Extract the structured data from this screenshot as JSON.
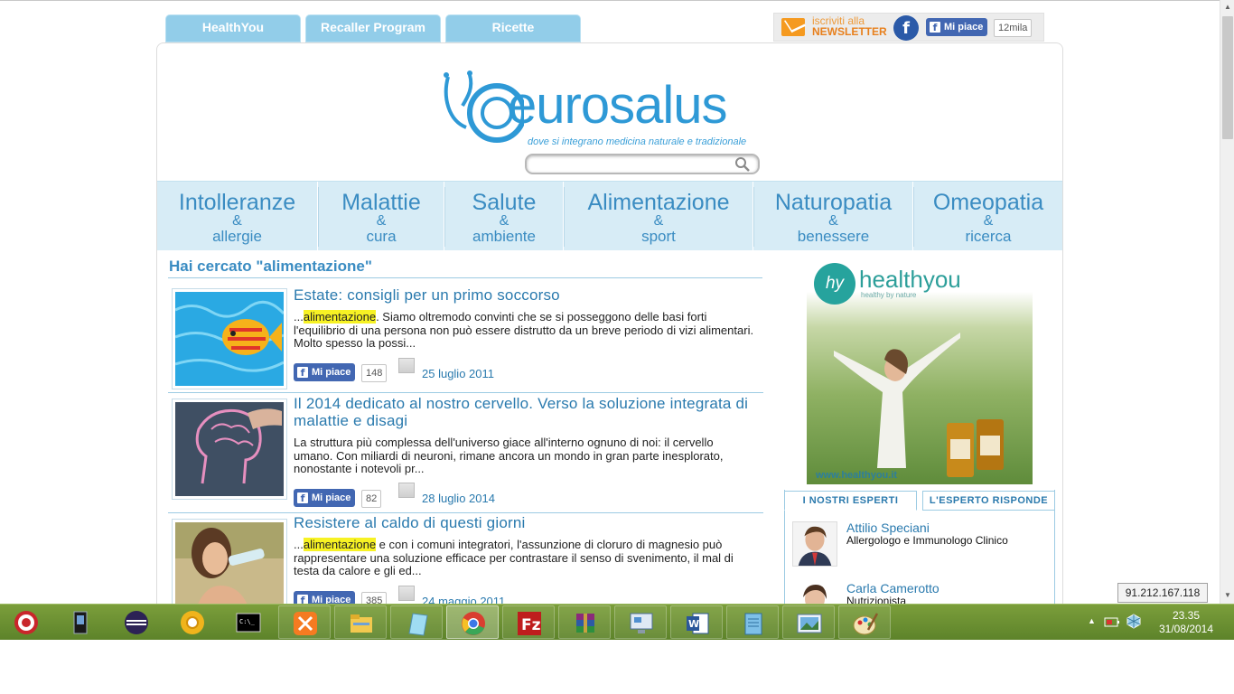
{
  "top_tabs": [
    "HealthYou",
    "Recaller Program",
    "Ricette"
  ],
  "social": {
    "newsletter_top": "iscriviti alla",
    "newsletter_bottom": "NEWSLETTER",
    "fb_letter": "f",
    "like_label": "Mi piace",
    "like_count": "12mila"
  },
  "logo": {
    "brand": "eurosalus",
    "tagline": "dove si integrano medicina naturale e tradizionale"
  },
  "search": {
    "value": ""
  },
  "nav": [
    {
      "main": "Intolleranze",
      "amp": "&",
      "sub": "allergie"
    },
    {
      "main": "Malattie",
      "amp": "&",
      "sub": "cura"
    },
    {
      "main": "Salute",
      "amp": "&",
      "sub": "ambiente"
    },
    {
      "main": "Alimentazione",
      "amp": "&",
      "sub": "sport"
    },
    {
      "main": "Naturopatia",
      "amp": "&",
      "sub": "benessere"
    },
    {
      "main": "Omeopatia",
      "amp": "&",
      "sub": "ricerca"
    }
  ],
  "results_title": "Hai cercato \"alimentazione\"",
  "results": [
    {
      "title": "Estate: consigli per un primo soccorso",
      "text_pre": "...",
      "highlight": "alimentazione",
      "text_post": ". Siamo oltremodo convinti che se si posseggono delle basi forti l'equilibrio di una persona non può essere distrutto da un breve periodo di vizi alimentari. Molto spesso la possi...",
      "like_label": "Mi piace",
      "like_count": "148",
      "date": "25 luglio 2011"
    },
    {
      "title": "Il 2014 dedicato al nostro cervello. Verso la soluzione integrata di malattie e disagi",
      "text_pre": "La struttura più complessa dell'universo giace all'interno ognuno di noi: il cervello umano. Con miliardi di neuroni, rimane ancora un mondo in gran parte inesplorato, nonostante i notevoli pr...",
      "highlight": "",
      "text_post": "",
      "like_label": "Mi piace",
      "like_count": "82",
      "date": "28 luglio 2014"
    },
    {
      "title": "Resistere al caldo di questi giorni",
      "text_pre": "...",
      "highlight": "alimentazione",
      "text_post": " e con i comuni integratori, l'assunzione di cloruro di magnesio può rappresentare una soluzione efficace per contrastare il senso di svenimento, il mal di testa da calore e gli ed...",
      "like_label": "Mi piace",
      "like_count": "385",
      "date": "24 maggio 2011"
    }
  ],
  "ad": {
    "logo_initials": "hy",
    "logo_text": "healthyou",
    "tagline": "healthy by nature",
    "url": "www.healthyou.it"
  },
  "experts": {
    "tab_experts": "I NOSTRI ESPERTI",
    "tab_answers": "L'ESPERTO RISPONDE",
    "list": [
      {
        "name": "Attilio Speciani",
        "role": "Allergologo e Immunologo Clinico"
      },
      {
        "name": "Carla Camerotto",
        "role": "Nutrizionista"
      }
    ]
  },
  "ip_address": "91.212.167.118",
  "clock": {
    "time": "23.35",
    "date": "31/08/2014"
  },
  "colors": {
    "accent": "#3a8cc2",
    "nav_bg": "#d7ecf6",
    "tab_bg": "#92cde9",
    "highlight": "#f7f224",
    "taskbar": "#6e9233"
  }
}
